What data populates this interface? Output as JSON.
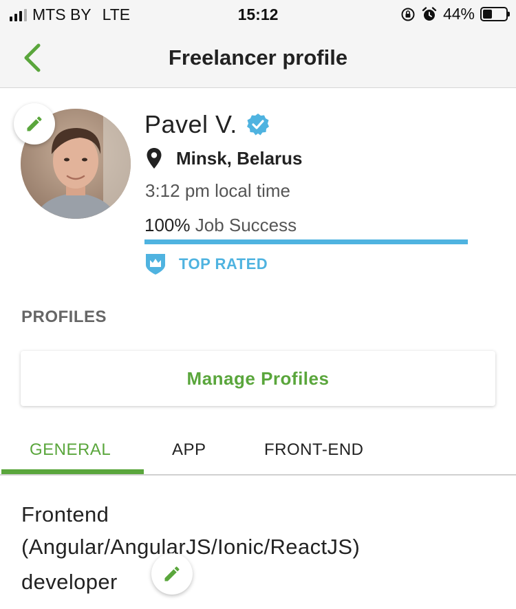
{
  "status_bar": {
    "carrier": "MTS BY",
    "network": "LTE",
    "time": "15:12",
    "battery": "44%",
    "battery_level": 0.44,
    "signal_bars": 3,
    "icons": [
      "signal-icon",
      "orientation-lock-icon",
      "alarm-icon",
      "battery-icon"
    ]
  },
  "nav": {
    "back_icon": "chevron-left-icon",
    "title": "Freelancer profile"
  },
  "profile": {
    "name": "Pavel V.",
    "verified_icon": "verified-badge-icon",
    "location": "Minsk, Belarus",
    "location_icon": "map-pin-icon",
    "local_time": "3:12 pm local time",
    "job_success_value": "100%",
    "job_success_label": "Job Success",
    "job_success_level": 1.0,
    "badge_text": "TOP RATED",
    "badge_icon": "top-rated-shield-icon",
    "edit_icon": "pencil-icon"
  },
  "profiles_section": {
    "title": "PROFILES",
    "manage_label": "Manage Profiles"
  },
  "tabs": [
    {
      "label": "GENERAL",
      "active": true
    },
    {
      "label": "APP",
      "active": false
    },
    {
      "label": "FRONT-END",
      "active": false
    }
  ],
  "general": {
    "title_line1": "Frontend",
    "title_line2": "(Angular/AngularJS/Ionic/ReactJS)",
    "title_line3": "developer"
  },
  "colors": {
    "accent_green": "#5aa63c",
    "accent_blue": "#4fb3e0",
    "text_dark": "#222222",
    "text_muted": "#555555"
  }
}
